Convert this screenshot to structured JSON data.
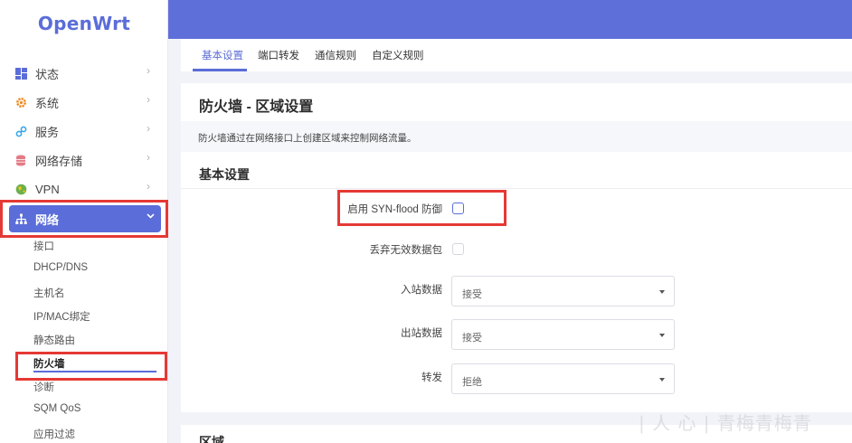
{
  "brand": "OpenWrt",
  "sidebar": {
    "items": [
      {
        "label": "状态"
      },
      {
        "label": "系统"
      },
      {
        "label": "服务"
      },
      {
        "label": "网络存储"
      },
      {
        "label": "VPN"
      },
      {
        "label": "网络"
      }
    ],
    "submenu": [
      {
        "label": "接口"
      },
      {
        "label": "DHCP/DNS"
      },
      {
        "label": "主机名"
      },
      {
        "label": "IP/MAC绑定"
      },
      {
        "label": "静态路由"
      },
      {
        "label": "防火墙"
      },
      {
        "label": "诊断"
      },
      {
        "label": "SQM QoS"
      },
      {
        "label": "应用过滤"
      }
    ]
  },
  "tabs": [
    {
      "label": "基本设置"
    },
    {
      "label": "端口转发"
    },
    {
      "label": "通信规则"
    },
    {
      "label": "自定义规则"
    }
  ],
  "page": {
    "title": "防火墙 - 区域设置",
    "description": "防火墙通过在网络接口上创建区域来控制网络流量。",
    "section_title": "基本设置",
    "fields": {
      "syn_flood": "启用 SYN-flood 防御",
      "drop_invalid": "丢弃无效数据包",
      "input": "入站数据",
      "output": "出站数据",
      "forward": "转发"
    },
    "selects": {
      "input_value": "接受",
      "output_value": "接受",
      "forward_value": "拒绝"
    },
    "next_section": "区域"
  },
  "watermark": "| 人 心 | 青梅青梅青",
  "colors": {
    "accent": "#5b6dd8",
    "header": "#5f6fd9",
    "highlight_red": "#e53935"
  }
}
